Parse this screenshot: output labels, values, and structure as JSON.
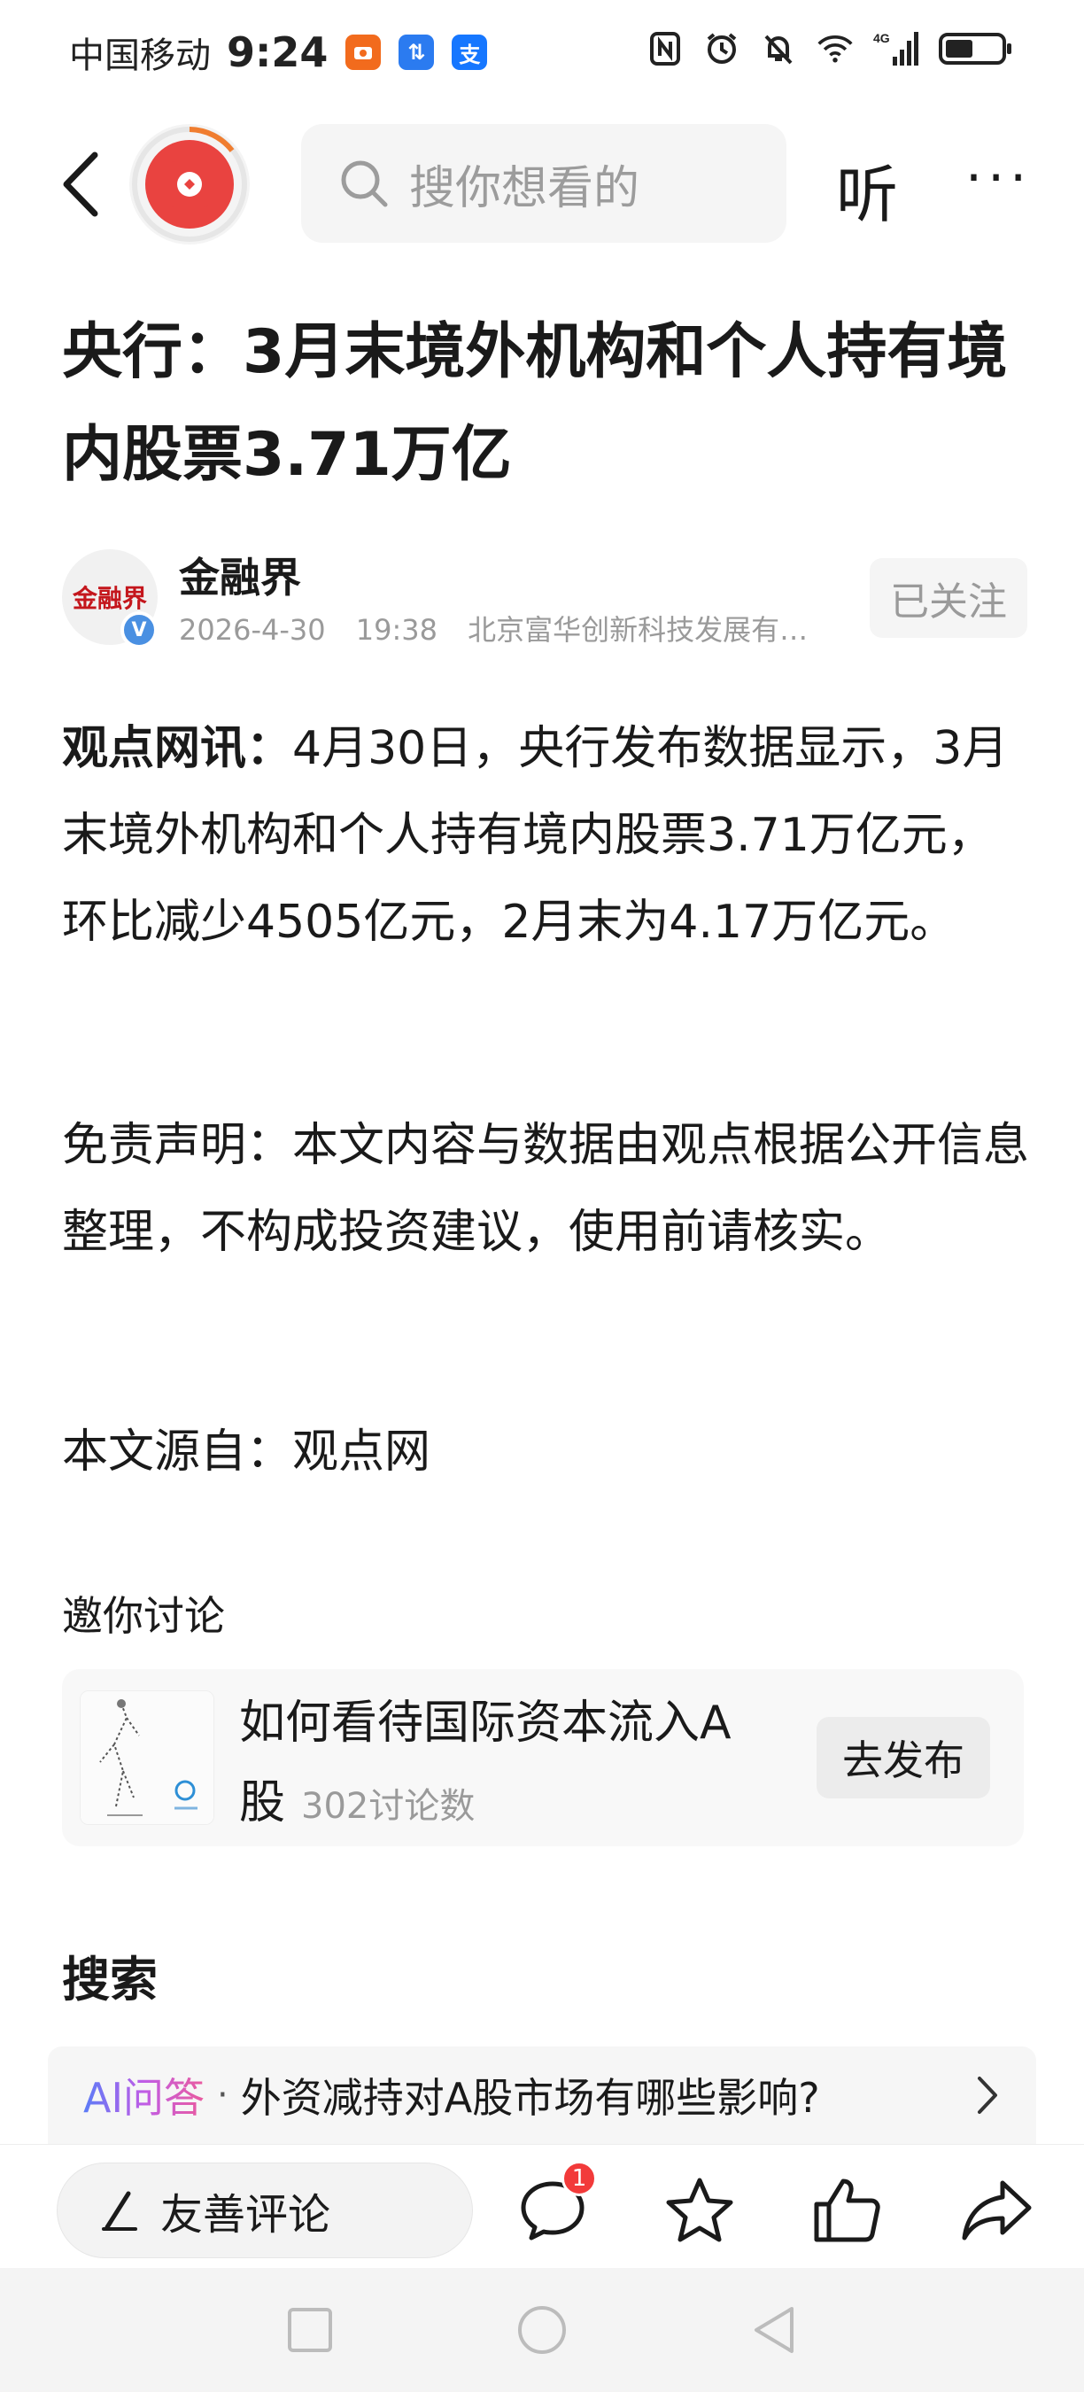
{
  "status_bar": {
    "carrier": "中国移动",
    "time": "9:24",
    "badge_icons": [
      "taobao-icon",
      "app-badge-icon",
      "alipay-icon"
    ],
    "badge_labels": [
      "",
      "⇅",
      "支"
    ],
    "network": "4G",
    "icons": [
      "nfc-icon",
      "alarm-icon",
      "mute-icon",
      "wifi-icon",
      "signal-icon",
      "battery-icon"
    ]
  },
  "top_nav": {
    "search_placeholder": "搜你想看的",
    "listen_label": "听",
    "more_label": "···"
  },
  "article": {
    "title": "央行：3月末境外机构和个人持有境内股票3.71万亿",
    "author": {
      "name": "金融界",
      "avatar_text": "金融界",
      "verified_mark": "V",
      "date": "2026-4-30",
      "time": "19:38",
      "publisher": "北京富华创新科技发展有…",
      "follow_label": "已关注"
    },
    "paragraph1_lead": "观点网讯：",
    "paragraph1_body": "4月30日，央行发布数据显示，3月末境外机构和个人持有境内股票3.71万亿元，环比减少4505亿元，2月末为4.17万亿元。",
    "paragraph2": "免责声明：本文内容与数据由观点根据公开信息整理，不构成投资建议，使用前请核实。",
    "paragraph3": "本文源自：观点网"
  },
  "discussion": {
    "label": "邀你讨论",
    "topic": "如何看待国际资本流入A股",
    "count": "302讨论数",
    "publish_label": "去发布"
  },
  "search_section": {
    "heading": "搜索",
    "ai_tag": "AI问答",
    "separator": "·",
    "question": "外资减持对A股市场有哪些影响?"
  },
  "bottom_bar": {
    "comment_placeholder": "友善评论",
    "comment_badge": "1"
  },
  "colors": {
    "accent_red": "#e94340",
    "badge_red": "#f23a3a",
    "verified_blue": "#4a90e2"
  }
}
